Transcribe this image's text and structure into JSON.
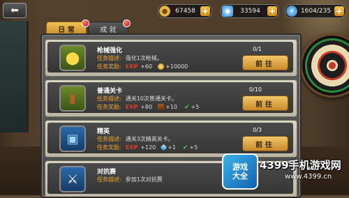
{
  "resources": {
    "gold": {
      "value": "67458",
      "icon": "gold-coin-icon"
    },
    "gems": {
      "value": "33594",
      "icon": "gem-icon"
    },
    "energy": {
      "value": "1604/235",
      "icon": "energy-icon"
    },
    "plus": "+"
  },
  "nav": {
    "back_icon": "back-arrow-icon",
    "back_glyph": "⬅"
  },
  "tabs": [
    {
      "label": "日 常",
      "active": true
    },
    {
      "label": "成 就",
      "active": false
    }
  ],
  "tasks": [
    {
      "title": "枪械强化",
      "desc_label": "任务描述:",
      "desc": "强化1次枪械。",
      "reward_label": "任务奖励:",
      "exp_label": "EXP",
      "exp": "+60",
      "reward2": "+10000",
      "reward3": "",
      "progress": "0/1",
      "button": "前往",
      "icon": "gold-medal-icon"
    },
    {
      "title": "普通关卡",
      "desc_label": "任务描述:",
      "desc": "通关10次普通关卡。",
      "reward_label": "任务奖励:",
      "exp_label": "EXP",
      "exp": "+80",
      "reward2": "+10",
      "reward3": "+5",
      "progress": "0/10",
      "button": "前往",
      "icon": "book-icon"
    },
    {
      "title": "精英",
      "desc_label": "任务描述:",
      "desc": "通关3次精英关卡。",
      "reward_label": "任务奖励:",
      "exp_label": "EXP",
      "exp": "+120",
      "reward2": "+1",
      "reward3": "+5",
      "progress": "0/3",
      "button": "前往",
      "icon": "briefcase-icon"
    },
    {
      "title": "对抗赛",
      "desc_label": "任务描述:",
      "desc": "参加1次对抗赛",
      "icon": "sword-icon"
    }
  ],
  "watermark": {
    "logo_line1": "游戏",
    "logo_line2": "大全",
    "text1": "4399手机游戏网",
    "text2": "www.4399.cn"
  },
  "colors": {
    "accent": "#f0c454",
    "exp": "#d93c2a",
    "reward_label": "#f0a93a"
  }
}
